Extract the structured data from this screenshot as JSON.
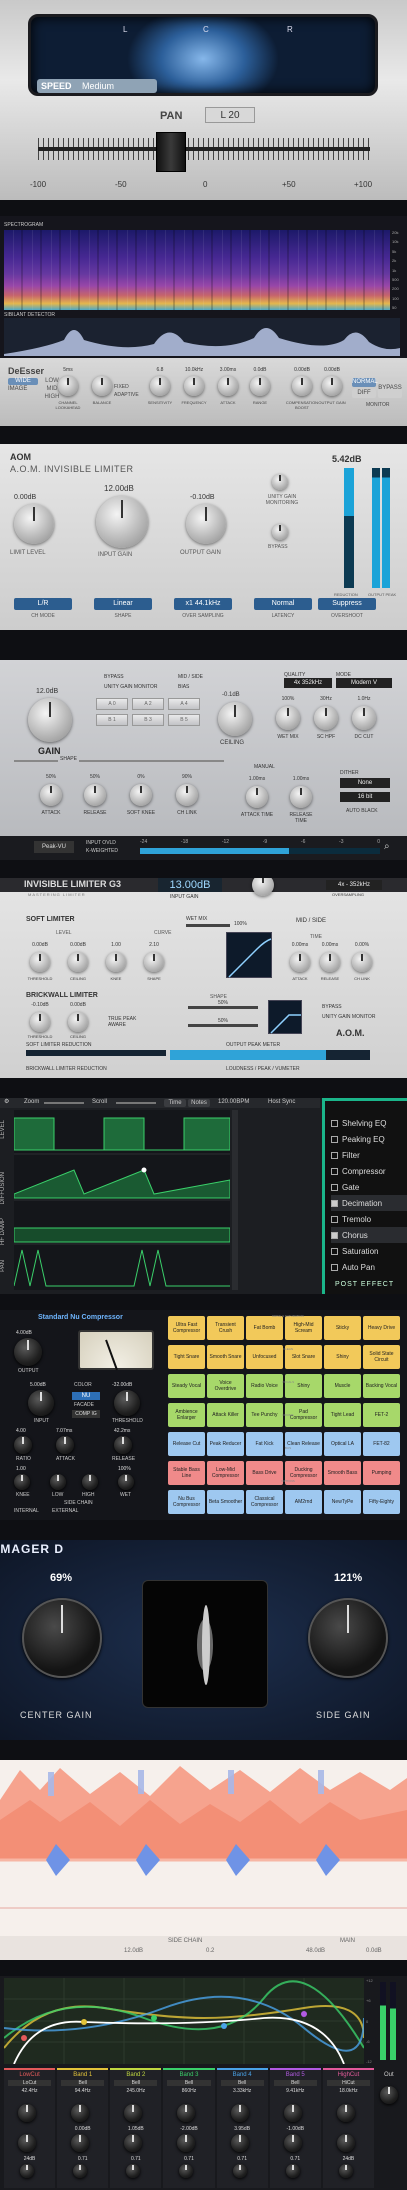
{
  "pan_plugin": {
    "scope_labels": [
      "L",
      "C",
      "R"
    ],
    "speed_label": "SPEED",
    "speed_value": "Medium",
    "pan_label": "PAN",
    "pan_value": "L 20",
    "scale": [
      "-100",
      "-50",
      "0",
      "+50",
      "+100"
    ]
  },
  "spectrogram": {
    "title": "SPECTROGRAM",
    "detector_label": "SIBILANT DETECTOR",
    "freq_labels": [
      "20k",
      "10k",
      "5k",
      "2k",
      "1k",
      "500",
      "200",
      "100",
      "50"
    ],
    "logo": "DeEsser",
    "mode_labels": [
      "WIDE",
      "LOW",
      "MID",
      "HIGH"
    ],
    "image_label": "IMAGE",
    "controls": [
      {
        "label": "CHANNEL LOOKAHEAD",
        "value": "5ms"
      },
      {
        "label": "BALANCE",
        "value": ""
      },
      {
        "label": "SENSITIVITY",
        "value": "6.8"
      },
      {
        "label": "FREQUENCY",
        "value": "10.0kHz"
      },
      {
        "label": "ATTACK",
        "value": "3.00ms"
      },
      {
        "label": "RANGE",
        "value": "0.0dB"
      },
      {
        "label": "COMPENSATION BOOST",
        "value": "0.00dB"
      },
      {
        "label": "OUTPUT GAIN",
        "value": "0.00dB"
      }
    ],
    "options": [
      "FIXED",
      "ADAPTIVE"
    ],
    "monitor_buttons": [
      "NORMAL",
      "DIFF",
      "BYPASS"
    ],
    "monitor_label": "MONITOR",
    "mode_btns": [
      "TOTAL",
      "S/A"
    ]
  },
  "aom_limiter": {
    "brand": "AOM",
    "title": "A.O.M. INVISIBLE LIMITER",
    "reduction": "5.42dB",
    "knobs": [
      {
        "label": "LIMIT LEVEL",
        "value": "0.00dB"
      },
      {
        "label": "INPUT GAIN",
        "value": "12.00dB"
      },
      {
        "label": "OUTPUT GAIN",
        "value": "-0.10dB"
      }
    ],
    "switch_labels": [
      "UNITY GAIN MONITORING",
      "BYPASS"
    ],
    "modes": [
      {
        "label": "CH MODE",
        "value": "L/R"
      },
      {
        "label": "SHAPE",
        "value": "Linear"
      },
      {
        "label": "OVER SAMPLING",
        "value": "x1 44.1kHz"
      },
      {
        "label": "LATENCY",
        "value": "Normal"
      },
      {
        "label": "OVERSHOOT",
        "value": "Suppress"
      }
    ],
    "meter_labels": [
      "REDUCTION",
      "OUTPUT PEAK"
    ]
  },
  "gain_limiter": {
    "gain_label": "GAIN",
    "gain_value": "12.0dB",
    "options": [
      "BYPASS",
      "UNITY GAIN MONITOR",
      "MID / SIDE",
      "BIAS"
    ],
    "presets": [
      "A 0",
      "A 2",
      "A 4",
      "B 1",
      "B 3",
      "B 5"
    ],
    "ceiling_label": "CEILING",
    "ceiling_value": "-0.1dB",
    "quality_label": "QUALITY",
    "quality_value": "4x 352kHz",
    "mode_label": "MODE",
    "mode_value": "Modern V",
    "knobs": [
      {
        "label": "WET MIX",
        "value": "100%"
      },
      {
        "label": "SC HPF",
        "value": "30Hz"
      },
      {
        "label": "DC CUT",
        "value": "1.0Hz"
      }
    ],
    "shape_label": "SHAPE",
    "shape_knobs": [
      {
        "label": "ATTACK",
        "value": "50%"
      },
      {
        "label": "RELEASE",
        "value": "50%"
      },
      {
        "label": "SOFT KNEE",
        "value": "0%"
      },
      {
        "label": "CH LINK",
        "value": "90%"
      }
    ],
    "manual_label": "MANUAL",
    "time_knobs": [
      {
        "label": "ATTACK TIME",
        "value": "1.00ms"
      },
      {
        "label": "RELEASE TIME",
        "value": "1.00ms"
      }
    ],
    "dither_label": "DITHER",
    "dither_value": "None",
    "bits": "16 bit",
    "auto_black": "AUTO BLACK",
    "meter_mode": "Peak-VU",
    "meter_opts": [
      "INPUT OVLD",
      "K-WEIGHTED"
    ],
    "meter_scale": [
      "-24",
      "-18",
      "-12",
      "-9",
      "-6",
      "-3",
      "0"
    ]
  },
  "limiter3": {
    "title": "INVISIBLE LIMITER G3",
    "subtitle": "MASTERING LIMITER",
    "input_value": "13.00dB",
    "input_label": "INPUT GAIN",
    "oversampling": "4x - 352kHz",
    "oversampling_label": "OVERSAMPLING",
    "soft_limiter": "SOFT LIMITER",
    "wet_mix_label": "WET MIX",
    "wet_mix_value": "100%",
    "mid_side": "MID / SIDE",
    "level_label": "LEVEL",
    "curve_label": "CURVE",
    "time_label": "TIME",
    "soft_knobs": [
      {
        "label": "THRESHOLD",
        "value": "0.00dB"
      },
      {
        "label": "CEILING",
        "value": "0.00dB"
      },
      {
        "label": "KNEE",
        "value": "1.00"
      },
      {
        "label": "SHAPE",
        "value": "2.10"
      },
      {
        "label": "ATTACK",
        "value": "0.00ms"
      },
      {
        "label": "RELEASE",
        "value": "0.00ms"
      },
      {
        "label": "CH LINK",
        "value": "0.00%"
      }
    ],
    "brickwall": "BRICKWALL LIMITER",
    "brick_knobs": [
      {
        "label": "THRESHOLD",
        "value": "-0.10dB"
      },
      {
        "label": "CEILING",
        "value": "0.00dB"
      }
    ],
    "true_peak": "TRUE PEAK AWARE",
    "shape_label": "SHAPE",
    "attack_value": "50%",
    "release_value": "50%",
    "bypass": "BYPASS",
    "unity": "UNITY GAIN MONITOR",
    "brand": "A.O.M.",
    "meter1": "SOFT LIMITER REDUCTION",
    "meter2": "OUTPUT PEAK METER",
    "meter3": "BRICKWALL LIMITER REDUCTION",
    "meter4": "LOUDNESS / PEAK / VUMETER"
  },
  "automation": {
    "zoom": "Zoom",
    "scroll": "Scroll",
    "time_btn": "Time",
    "notes_btn": "Notes",
    "bpm": "120.00BPM",
    "host_sync": "Host Sync",
    "lanes": [
      "LEVEL",
      "DIFFUSION",
      "HF DAMP",
      "PAN"
    ],
    "effects": [
      {
        "label": "Shelving EQ",
        "checked": false
      },
      {
        "label": "Peaking EQ",
        "checked": false
      },
      {
        "label": "Filter",
        "checked": false
      },
      {
        "label": "Compressor",
        "checked": false
      },
      {
        "label": "Gate",
        "checked": false
      },
      {
        "label": "Decimation",
        "checked": true
      },
      {
        "label": "Tremolo",
        "checked": false
      },
      {
        "label": "Chorus",
        "checked": true
      },
      {
        "label": "Saturation",
        "checked": false
      },
      {
        "label": "Auto Pan",
        "checked": false
      }
    ],
    "post_effect": "POST EFFECT"
  },
  "nu_comp": {
    "title": "Standard Nu Compressor",
    "output_label": "OUTPUT",
    "output_value": "4.00dB",
    "input_label": "INPUT",
    "input_value": "5.00dB",
    "threshold_label": "THRESHOLD",
    "threshold_value": "-32.00dB",
    "color_label": "COLOR",
    "color_value": "NU",
    "facade": "FACADE",
    "comp_label": "COMP IG",
    "ratio_label": "RATIO",
    "ratio_value": "4.00",
    "attack_label": "ATTACK",
    "attack_value": "7.07ms",
    "release_label": "RELEASE",
    "release_value": "42.2ms",
    "knee_label": "KNEE",
    "knee_value": "1.00",
    "sc_label": "SIDE CHAIN",
    "low_label": "LOW",
    "high_label": "HIGH",
    "wet_label": "WET",
    "wet_value": "100%",
    "internal": "INTERNAL",
    "external": "EXTERNAL",
    "sections": [
      "DRIVE & SATURATION",
      "CLEAN",
      "VOCALS",
      "DRUMS",
      "BUS",
      "OPTIONS"
    ],
    "presets": [
      [
        "Ultra Fast Compressor",
        "Transient Crush",
        "Fat Bomb",
        "High-Mid Scream",
        "Sticky",
        "Heavy Drive"
      ],
      [
        "Tight Snare",
        "Smooth Snare",
        "Unfocused",
        "Slot Snare",
        "Shiny",
        "Solid State Circuit"
      ],
      [
        "Steady Vocal",
        "Voice Overdrive",
        "Radio Voice",
        "Shiny",
        "Muscle",
        "Backing Vocal"
      ],
      [
        "Ambience Enlarger",
        "Attack Killer",
        "Tee Punchy",
        "Pad Compressor",
        "Tight Lead",
        "FET-2"
      ],
      [
        "Release Cut",
        "Peak Reducer",
        "Fat Kick",
        "Clean Release",
        "Optical LA",
        "FET-82"
      ],
      [
        "Stable Bass Line",
        "Low-Mid Compressor",
        "Bass Drive",
        "Ducking Compressor",
        "Smooth Bass",
        "Pumping"
      ],
      [
        "Nu Bus Compressor",
        "Beta Smoother",
        "Classical Compressor",
        "AM2rnd",
        "NewTyPe",
        "Fifty-Eighty"
      ]
    ]
  },
  "imager": {
    "title": "IMAGER D",
    "center_label": "CENTER GAIN",
    "center_value": "69%",
    "side_label": "SIDE GAIN",
    "side_value": "121%"
  },
  "waveform": {
    "side_chain": "SIDE CHAIN",
    "main": "MAIN",
    "sc_value": "12.0dB",
    "mid_value": "0.2",
    "main_value": "48.0dB",
    "out_value": "0.0dB"
  },
  "eq": {
    "bands": [
      "LowCut",
      "Band 1",
      "Band 2",
      "Band 3",
      "Band 4",
      "Band 5",
      "HighCut"
    ],
    "types": [
      "LoCut",
      "Bell",
      "Bell",
      "Bell",
      "Bell",
      "Bell",
      "HiCut"
    ],
    "freqs": [
      "42.4Hz",
      "94.4Hz",
      "245.0Hz",
      "860Hz",
      "3.33kHz",
      "9.41kHz",
      "18.0kHz"
    ],
    "gains": [
      "",
      "0.00dB",
      "1.05dB",
      "-2.00dB",
      "3.95dB",
      "-1.00dB",
      ""
    ],
    "qs": [
      "24dB",
      "0.71",
      "0.71",
      "0.71",
      "0.71",
      "0.71",
      "24dB"
    ],
    "out_label": "Out",
    "db_scale": [
      "+12",
      "+6",
      "0",
      "-6",
      "-12"
    ]
  }
}
